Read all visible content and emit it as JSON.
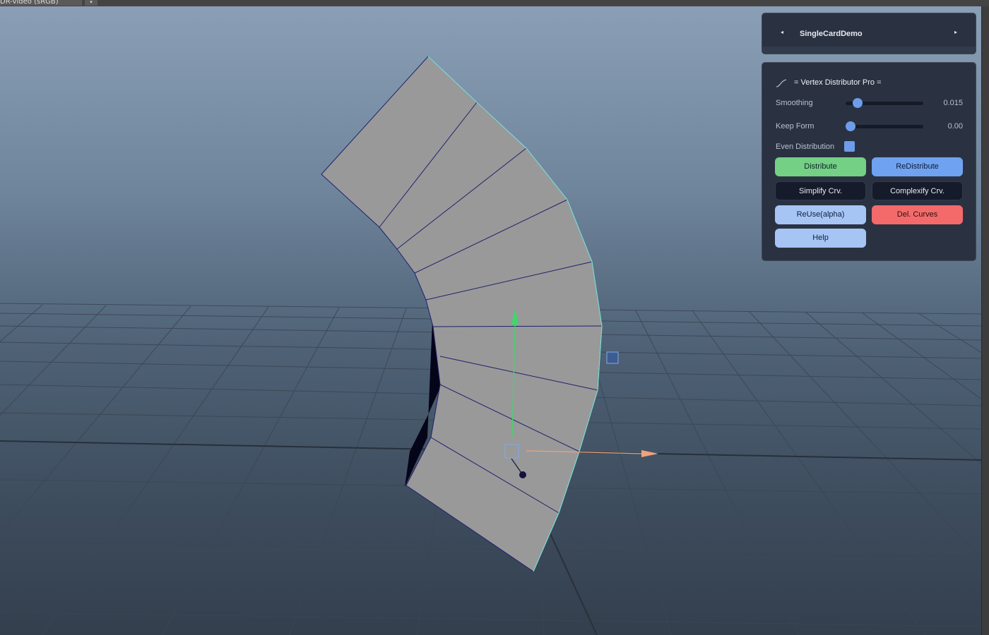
{
  "viewport": {
    "color_space_label": "DR-video (sRGB)",
    "color_space_arrow": "▾"
  },
  "shelf": {
    "title": "SingleCardDemo",
    "prev_icon": "◂",
    "next_icon": "▸"
  },
  "tool": {
    "title": "= Vertex Distributor Pro =",
    "icon": "curve-icon",
    "smoothing": {
      "label": "Smoothing",
      "value": "0.015",
      "level": 0.1
    },
    "keep_form": {
      "label": "Keep Form",
      "value": "0.00",
      "level": 0.0
    },
    "even_distribution": {
      "label": "Even Distribution",
      "checked": true
    },
    "buttons": {
      "distribute": "Distribute",
      "redistribute": "ReDistribute",
      "simplify": "Simplify Crv.",
      "complexify": "Complexify Crv.",
      "reuse": "ReUse(alpha)",
      "delete_curves": "Del. Curves",
      "help": "Help"
    }
  },
  "colors": {
    "accent_blue": "#6d9de9",
    "green": "#73d084",
    "red": "#f46a6a",
    "panel_bg": "#2a3242"
  }
}
